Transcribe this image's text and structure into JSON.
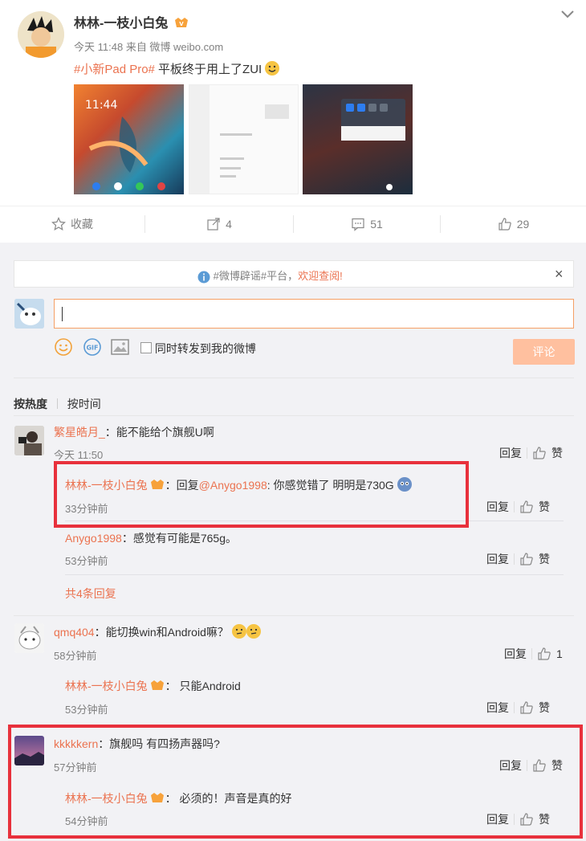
{
  "post": {
    "author": "林林-一枝小白兔",
    "meta_time": "今天 11:48",
    "meta_from": "来自 微博 weibo.com",
    "hashtag": "#小新Pad Pro#",
    "text": " 平板终于用上了ZUI",
    "actions": {
      "favorite_label": "收藏",
      "repost_count": "4",
      "comment_count": "51",
      "like_count": "29"
    }
  },
  "notice": {
    "prefix": "#微博辟谣#平台，",
    "link": "欢迎查阅!",
    "close": "×"
  },
  "composer": {
    "input_value": "",
    "checkbox_label": "同时转发到我的微博",
    "submit_label": "评论"
  },
  "sort": {
    "hot": "按热度",
    "time": "按时间"
  },
  "comments": [
    {
      "user": "繁星皓月_",
      "text": "：能不能给个旗舰U啊",
      "time": "今天 11:50",
      "reply": "回复",
      "like": "赞",
      "replies": [
        {
          "user": "林林-一枝小白兔",
          "pre": "：回复",
          "mention": "@Anygo1998",
          "text": ": 你感觉错了 明明是730G",
          "time": "33分钟前",
          "reply": "回复",
          "like": "赞"
        },
        {
          "user": "Anygo1998",
          "pre": "",
          "mention": "",
          "text": "：感觉有可能是765g。",
          "time": "53分钟前",
          "reply": "回复",
          "like": "赞"
        }
      ],
      "more": "共4条回复"
    },
    {
      "user": "qmq404",
      "text": "：能切换win和Android嘛？",
      "time": "58分钟前",
      "reply": "回复",
      "like": "1",
      "replies": [
        {
          "user": "林林-一枝小白兔",
          "pre": "",
          "mention": "",
          "text": "： 只能Android",
          "time": "53分钟前",
          "reply": "回复",
          "like": "赞"
        }
      ]
    },
    {
      "user": "kkkkkern",
      "text": "：旗舰吗  有四扬声器吗?",
      "time": "57分钟前",
      "reply": "回复",
      "like": "赞",
      "replies": [
        {
          "user": "林林-一枝小白兔",
          "pre": "",
          "mention": "",
          "text": "： 必须的！声音是真的好",
          "time": "54分钟前",
          "reply": "回复",
          "like": "赞"
        }
      ]
    }
  ],
  "colors": {
    "link": "#eb7350",
    "highlight_box": "#e8313c",
    "submit_bg": "#ffc09f",
    "reply_bg": "#f2f2f5"
  },
  "icons": [
    "star-icon",
    "repost-icon",
    "comment-icon",
    "thumb-up-icon",
    "info-icon",
    "smile-icon",
    "gif-icon",
    "image-icon",
    "chevron-down-icon"
  ]
}
